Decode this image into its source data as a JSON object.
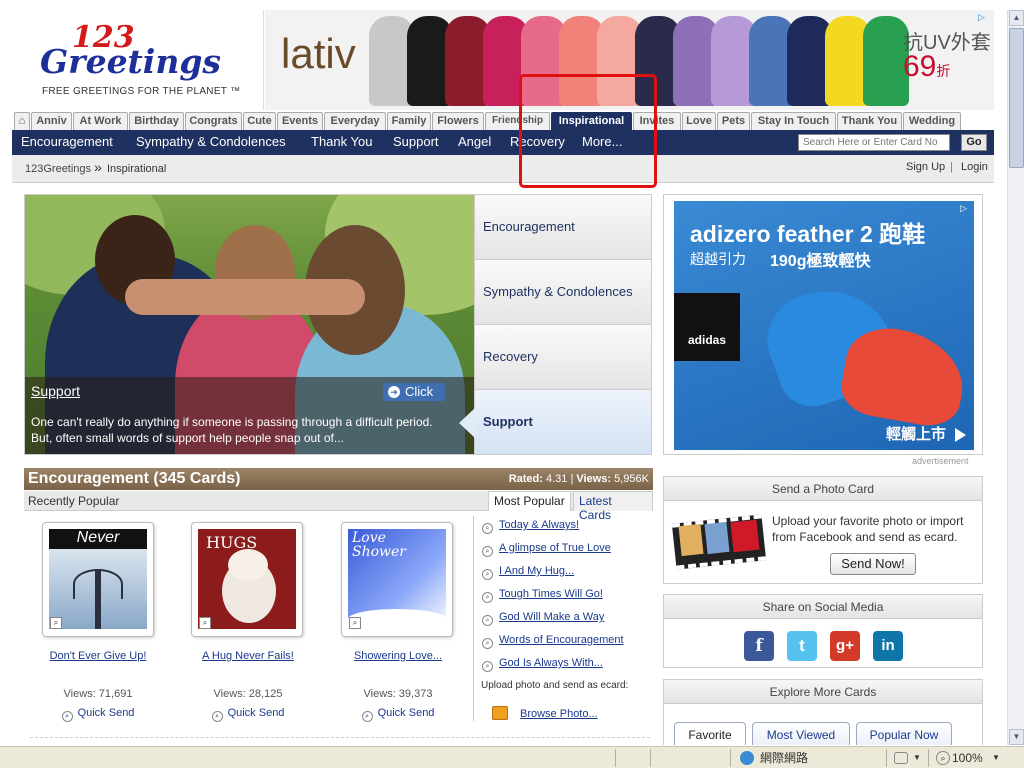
{
  "header": {
    "logo_line1": "123",
    "logo_line2": "Greetings",
    "tagline": "FREE GREETINGS FOR THE PLANET ™",
    "banner_brand": "lativ",
    "banner_cn": "抗UV外套",
    "banner_price": "69",
    "banner_price_unit": "折"
  },
  "category_tabs": [
    "Anniv",
    "At Work",
    "Birthday",
    "Congrats",
    "Cute",
    "Events",
    "Everyday",
    "Family",
    "Flowers",
    "Friendship",
    "Inspirational",
    "Invites",
    "Love",
    "Pets",
    "Stay In Touch",
    "Thank You",
    "Wedding"
  ],
  "active_tab": "Inspirational",
  "subnav": [
    "Encouragement",
    "Sympathy & Condolences",
    "Thank You",
    "Support",
    "Angel",
    "Recovery",
    "More..."
  ],
  "search": {
    "placeholder": "Search Here or Enter Card No",
    "go_label": "Go"
  },
  "breadcrumb": {
    "home": "123Greetings",
    "sep": "»",
    "current": "Inspirational",
    "signup": "Sign Up",
    "divider": "|",
    "login": "Login"
  },
  "hero": {
    "title": "Support",
    "click_label": "Click",
    "description": "One can't really do anything if someone is passing through a difficult period. But, often small words of support help people snap out of...",
    "tabs": [
      "Encouragement",
      "Sympathy & Condolences",
      "Recovery",
      "Support"
    ],
    "selected_tab": "Support"
  },
  "ad": {
    "headline": "adizero feather 2 跑鞋",
    "sub1": "超越引力",
    "sub2": "190g極致輕快",
    "logo": "adidas",
    "cta": "輕觸上市",
    "label": "advertisement"
  },
  "encouragement": {
    "title": "Encouragement (345 Cards)",
    "rated_label": "Rated:",
    "rated_value": "4.31",
    "views_label": "Views:",
    "views_value": "5,956K",
    "recently_popular": "Recently Popular",
    "tab_popular": "Most Popular",
    "tab_latest": "Latest Cards",
    "cards": [
      {
        "image_text": "Never",
        "name": "Don't Ever Give Up!",
        "views": "Views: 71,691",
        "quick": "Quick Send"
      },
      {
        "image_text": "HUGS",
        "name": "A Hug Never Fails!",
        "views": "Views: 28,125",
        "quick": "Quick Send"
      },
      {
        "image_text": "Love Shower",
        "name": "Showering Love...",
        "views": "Views: 39,373",
        "quick": "Quick Send"
      }
    ],
    "popular_list": [
      "Today & Always!",
      "A glimpse of True Love",
      "I And My Hug...",
      "Tough Times Will Go!",
      "God Will Make a Way",
      "Words of Encouragement",
      "God Is Always With..."
    ],
    "upload_text": "Upload photo and send as ecard:",
    "browse_label": "Browse Photo..."
  },
  "photo_card": {
    "title": "Send a Photo Card",
    "text": "Upload your favorite photo or import from Facebook and send as ecard.",
    "button": "Send Now!"
  },
  "social": {
    "title": "Share on Social Media",
    "icons": [
      "f",
      "t",
      "g+",
      "in"
    ]
  },
  "explore": {
    "title": "Explore More Cards",
    "tabs": [
      "Favorite",
      "Most Viewed",
      "Popular Now"
    ]
  },
  "statusbar": {
    "zone": "網際網路",
    "zoom": "100%"
  },
  "colors": {
    "nav": "#1e3160",
    "accent_red": "#e01010",
    "link": "#1a3a8c"
  }
}
